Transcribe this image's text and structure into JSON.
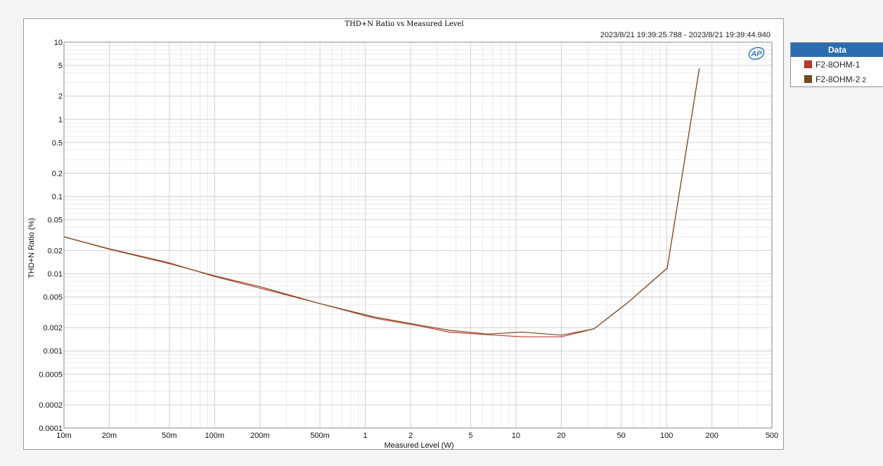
{
  "chart_data": {
    "type": "line",
    "title": "THD+N Ratio vs Measured Level",
    "subtitle": "2023/8/21 19:39:25.788 - 2023/8/21 19:39:44.940",
    "xlabel": "Measured Level (W)",
    "ylabel": "THD+N Ratio (%)",
    "x_scale": "log",
    "y_scale": "log",
    "xlim": [
      0.01,
      500
    ],
    "ylim": [
      0.0001,
      10
    ],
    "grid": true,
    "legend_position": "right",
    "x_ticks": [
      {
        "v": 0.01,
        "label": "10m"
      },
      {
        "v": 0.02,
        "label": "20m"
      },
      {
        "v": 0.05,
        "label": "50m"
      },
      {
        "v": 0.1,
        "label": "100m"
      },
      {
        "v": 0.2,
        "label": "200m"
      },
      {
        "v": 0.5,
        "label": "500m"
      },
      {
        "v": 1,
        "label": "1"
      },
      {
        "v": 2,
        "label": "2"
      },
      {
        "v": 5,
        "label": "5"
      },
      {
        "v": 10,
        "label": "10"
      },
      {
        "v": 20,
        "label": "20"
      },
      {
        "v": 50,
        "label": "50"
      },
      {
        "v": 100,
        "label": "100"
      },
      {
        "v": 200,
        "label": "200"
      },
      {
        "v": 500,
        "label": "500"
      }
    ],
    "y_ticks": [
      {
        "v": 10,
        "label": "10"
      },
      {
        "v": 5,
        "label": "5"
      },
      {
        "v": 2,
        "label": "2"
      },
      {
        "v": 1,
        "label": "1"
      },
      {
        "v": 0.5,
        "label": "0.5"
      },
      {
        "v": 0.2,
        "label": "0.2"
      },
      {
        "v": 0.1,
        "label": "0.1"
      },
      {
        "v": 0.05,
        "label": "0.05"
      },
      {
        "v": 0.02,
        "label": "0.02"
      },
      {
        "v": 0.01,
        "label": "0.01"
      },
      {
        "v": 0.005,
        "label": "0.005"
      },
      {
        "v": 0.002,
        "label": "0.002"
      },
      {
        "v": 0.001,
        "label": "0.001"
      },
      {
        "v": 0.0005,
        "label": "0.0005"
      },
      {
        "v": 0.0002,
        "label": "0.0002"
      },
      {
        "v": 0.0001,
        "label": "0.0001"
      }
    ],
    "series": [
      {
        "name": "F2-8OHM-1",
        "color": "#c0392b",
        "x": [
          0.01,
          0.02,
          0.05,
          0.1,
          0.2,
          0.5,
          1.15,
          2.3,
          3.6,
          6.5,
          11,
          20,
          33,
          55,
          101,
          165
        ],
        "y": [
          0.03,
          0.021,
          0.0138,
          0.0092,
          0.0065,
          0.0041,
          0.00265,
          0.0021,
          0.00175,
          0.00162,
          0.00152,
          0.00152,
          0.00193,
          0.0042,
          0.0118,
          4.6
        ]
      },
      {
        "name": "F2-8OHM-2",
        "name_suffix": "2",
        "color": "#7a4a1e",
        "x": [
          0.01,
          0.02,
          0.05,
          0.1,
          0.2,
          0.5,
          1.15,
          2.3,
          3.6,
          6.5,
          11,
          20,
          33,
          55,
          101,
          165
        ],
        "y": [
          0.03,
          0.0208,
          0.0135,
          0.0094,
          0.0068,
          0.0041,
          0.00275,
          0.00215,
          0.00185,
          0.00165,
          0.00175,
          0.0016,
          0.00193,
          0.0042,
          0.0118,
          4.6
        ]
      }
    ]
  },
  "legend": {
    "header": "Data",
    "items": [
      {
        "label": "F2-8OHM-1",
        "suffix": "",
        "color": "#c0392b"
      },
      {
        "label": "F2-8OHM-2",
        "suffix": "2",
        "color": "#7a4a1e"
      }
    ]
  },
  "logo": {
    "text": "AP",
    "color": "#2f7bbf"
  }
}
